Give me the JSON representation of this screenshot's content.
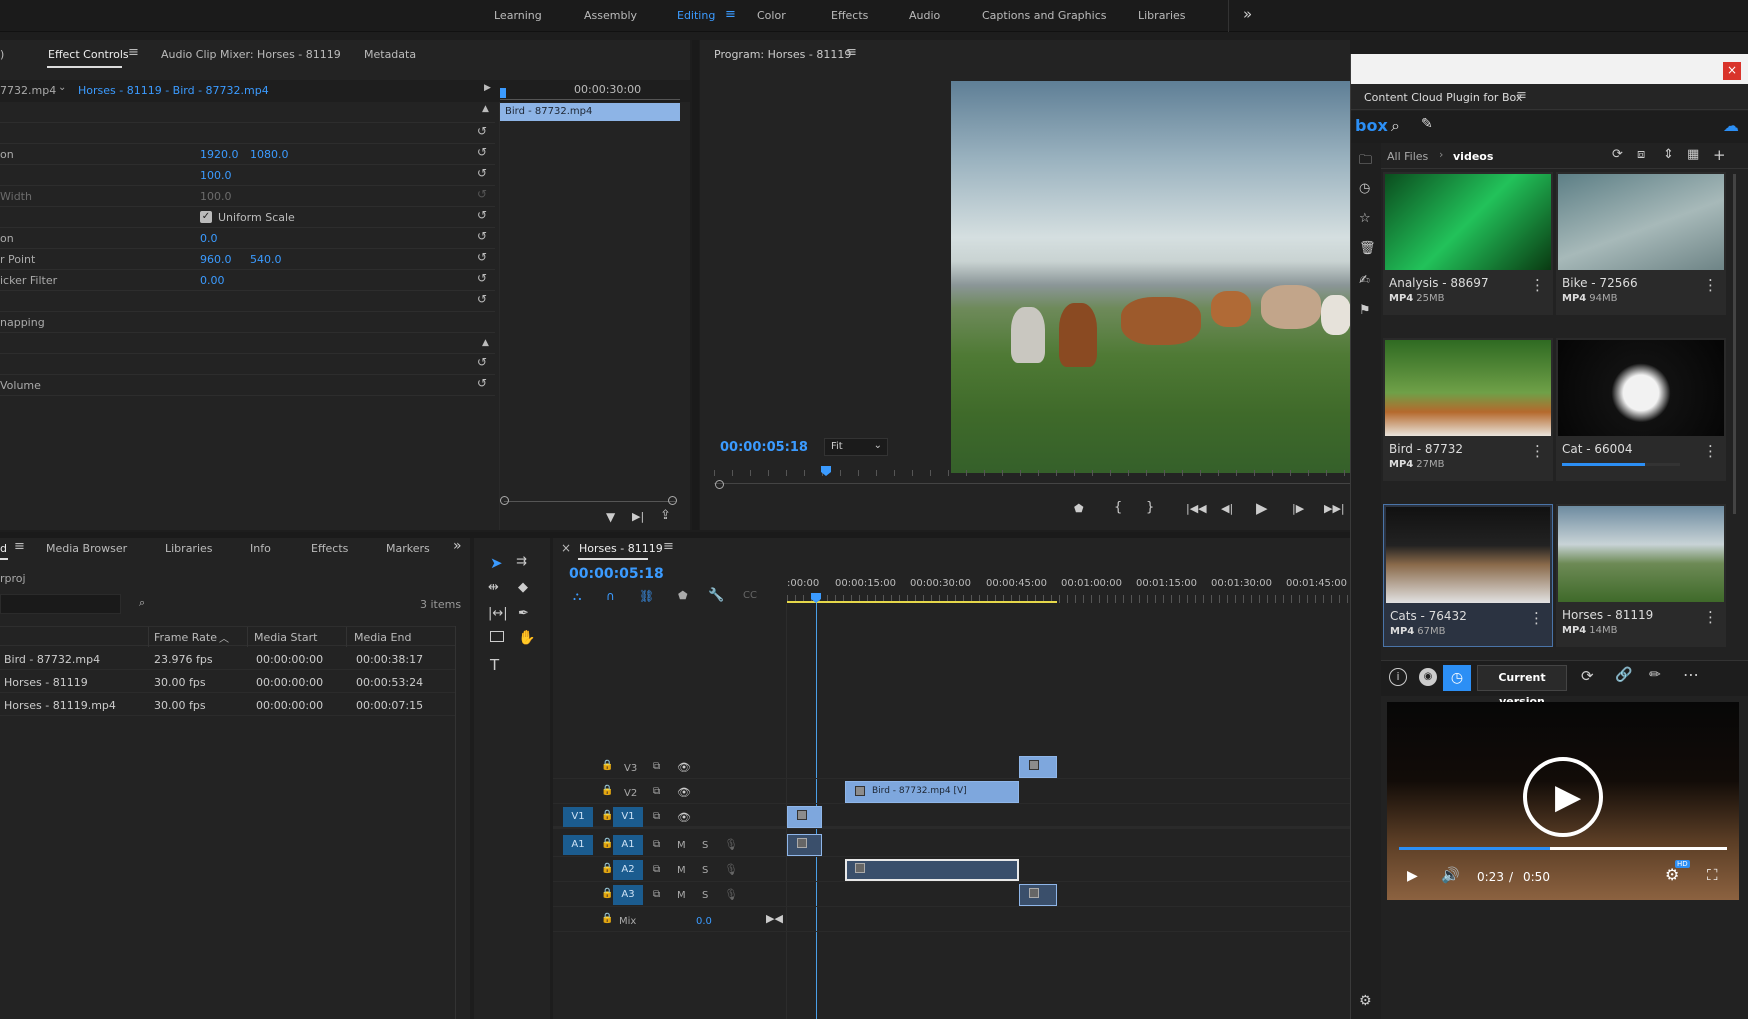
{
  "workspaces": [
    "Learning",
    "Assembly",
    "Editing",
    "Color",
    "Effects",
    "Audio",
    "Captions and Graphics",
    "Libraries"
  ],
  "active_workspace": "Editing",
  "more_workspaces": "»",
  "effect_panel": {
    "tabs": [
      ")",
      "Effect Controls",
      "Audio Clip Mixer: Horses - 81119",
      "Metadata"
    ],
    "source_clip": "7732.mp4",
    "sequence_clip": "Horses - 81119 - Bird - 87732.mp4",
    "timecode": "00:00:30:00",
    "clip_label": "Bird - 87732.mp4",
    "properties": [
      {
        "name": "on",
        "v1": "1920.0",
        "v2": "1080.0"
      },
      {
        "name": "",
        "v1": "100.0",
        "v2": ""
      },
      {
        "name": "Width",
        "v1": "100.0",
        "v2": ""
      },
      {
        "name": "",
        "v1": "Uniform Scale",
        "v2": ""
      },
      {
        "name": "on",
        "v1": "0.0",
        "v2": ""
      },
      {
        "name": "r Point",
        "v1": "960.0",
        "v2": "540.0"
      },
      {
        "name": "icker Filter",
        "v1": "0.00",
        "v2": ""
      },
      {
        "name": "napping",
        "v1": "",
        "v2": ""
      },
      {
        "name": "Volume",
        "v1": "",
        "v2": ""
      }
    ]
  },
  "program": {
    "title": "Program: Horses - 81119",
    "timecode": "00:00:05:18",
    "fit": "Fit"
  },
  "project_panel": {
    "tabs": [
      "d",
      "Media Browser",
      "Libraries",
      "Info",
      "Effects",
      "Markers"
    ],
    "more": "»",
    "project_name": "rproj",
    "items_count": "3 items",
    "columns": [
      "Frame Rate",
      "Media Start",
      "Media End"
    ],
    "rows": [
      {
        "name": "Bird - 87732.mp4",
        "rate": "23.976 fps",
        "start": "00:00:00:00",
        "end": "00:00:38:17"
      },
      {
        "name": "Horses - 81119",
        "rate": "30.00 fps",
        "start": "00:00:00:00",
        "end": "00:00:53:24"
      },
      {
        "name": "Horses - 81119.mp4",
        "rate": "30.00 fps",
        "start": "00:00:00:00",
        "end": "00:00:07:15"
      }
    ]
  },
  "timeline": {
    "close": "×",
    "title": "Horses - 81119",
    "timecode": "00:00:05:18",
    "ruler": [
      ":00:00",
      "00:00:15:00",
      "00:00:30:00",
      "00:00:45:00",
      "00:01:00:00",
      "00:01:15:00",
      "00:01:30:00",
      "00:01:45:00"
    ],
    "tracks": [
      {
        "label": "V3",
        "src": ""
      },
      {
        "label": "V2",
        "src": ""
      },
      {
        "label": "V1",
        "src": "V1"
      },
      {
        "label": "A1",
        "src": "A1"
      },
      {
        "label": "A2",
        "src": ""
      },
      {
        "label": "A3",
        "src": ""
      }
    ],
    "mix_label": "Mix",
    "mix_value": "0.0",
    "m": "M",
    "s": "S",
    "clip_v2": "Bird - 87732.mp4 [V]"
  },
  "box_plugin": {
    "close": "×",
    "title": "Content Cloud Plugin for Box",
    "logo": "box",
    "breadcrumb_root": "All Files",
    "breadcrumb_current": "videos",
    "files": [
      {
        "name": "Analysis - 88697",
        "type": "MP4",
        "size": "25MB"
      },
      {
        "name": "Bike - 72566",
        "type": "MP4",
        "size": "94MB"
      },
      {
        "name": "Bird - 87732",
        "type": "MP4",
        "size": "27MB"
      },
      {
        "name": "Cat - 66004",
        "type": "",
        "size": "",
        "progress": 0.7
      },
      {
        "name": "Cats - 76432",
        "type": "MP4",
        "size": "67MB"
      },
      {
        "name": "Horses - 81119",
        "type": "MP4",
        "size": "14MB"
      }
    ],
    "current_version": "Current version",
    "player": {
      "time": "0:23",
      "sep": "/",
      "duration": "0:50",
      "progress": 0.46,
      "hd": "HD"
    }
  },
  "colors": {
    "accent": "#3b9bff",
    "clip_video": "#7ea7dd",
    "clip_dark": "#3a4f6b",
    "track_src": "#1b5c8f",
    "playhead": "#4a9fe8"
  }
}
